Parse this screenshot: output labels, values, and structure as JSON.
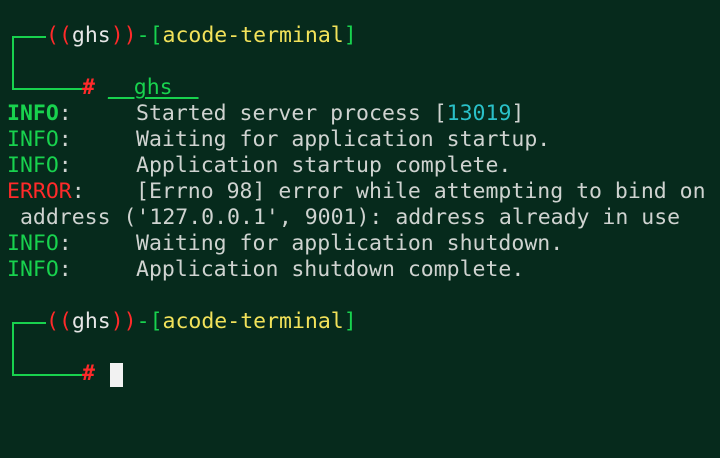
{
  "prompts": [
    {
      "open_paren": "((",
      "user": "ghs",
      "close_paren": "))",
      "dash": "-",
      "lbracket": "[",
      "host": "acode-terminal",
      "rbracket": "]",
      "hash": "#",
      "command": "__ghs__"
    },
    {
      "open_paren": "((",
      "user": "ghs",
      "close_paren": "))",
      "dash": "-",
      "lbracket": "[",
      "host": "acode-terminal",
      "rbracket": "]",
      "hash": "#",
      "command": ""
    }
  ],
  "log": [
    {
      "level": "INFO",
      "sep": ":",
      "text": "Started server process [",
      "pid": "13019",
      "tail": "]"
    },
    {
      "level": "INFO",
      "sep": ":",
      "text": "Waiting for application startup."
    },
    {
      "level": "INFO",
      "sep": ":",
      "text": "Application startup complete."
    },
    {
      "level": "ERROR",
      "sep": ":",
      "text": "[Errno 98] error while attempting to bind on"
    },
    {
      "continuation": " address ('127.0.0.1', 9001): address already in use"
    },
    {
      "level": "INFO",
      "sep": ":",
      "text": "Waiting for application shutdown."
    },
    {
      "level": "INFO",
      "sep": ":",
      "text": "Application shutdown complete."
    }
  ],
  "colors": {
    "background": "#062a1c",
    "info": "#18d24e",
    "error": "#ff2a2a",
    "host": "#f2e25a",
    "pid": "#2ac0c8",
    "text": "#cfd3d0"
  }
}
